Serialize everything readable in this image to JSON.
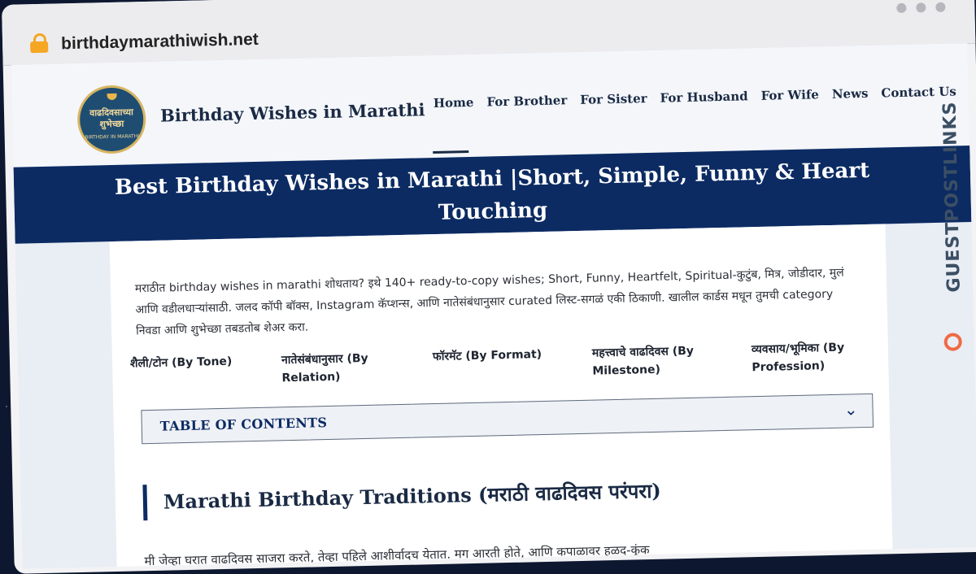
{
  "browser": {
    "url": "birthdaymarathiwish.net"
  },
  "site": {
    "logo_text_top": "वाढदिवसाच्या",
    "logo_text_main": "शुभेच्छा",
    "logo_text_bottom": "BIRTHDAY IN MARATHI",
    "title": "Birthday Wishes in Marathi",
    "nav": [
      "Home",
      "For Brother",
      "For Sister",
      "For Husband",
      "For Wife",
      "News",
      "Contact Us"
    ]
  },
  "hero": {
    "heading": "Best Birthday Wishes in Marathi |Short, Simple, Funny & Heart Touching"
  },
  "intro": {
    "text": "मराठीत birthday wishes in marathi शोधताय? इथे 140+ ready-to-copy wishes; Short, Funny, Heartfelt, Spiritual-कुटुंब, मित्र, जोडीदार, मुलं आणि वडीलधाऱ्यांसाठी. जलद कॉपी बॉक्स, Instagram कॅप्शन्स, आणि नातेसंबंधानुसार curated लिस्ट-सगळं एकी ठिकाणी. खालील कार्डस मधून तुमची category निवडा आणि शुभेच्छा तबडतोब शेअर करा."
  },
  "categories": [
    "शैली/टोन (By Tone)",
    "नातेसंबंधानुसार (By Relation)",
    "फॉरमॅट (By Format)",
    "महत्त्वाचे वाढदिवस (By Milestone)",
    "व्यवसाय/भूमिका (By Profession)"
  ],
  "toc": {
    "title": "TABLE OF CONTENTS",
    "icon": "chevron-down-icon"
  },
  "section": {
    "heading": "Marathi Birthday Traditions (मराठी वाढदिवस परंपरा)",
    "paragraph": "मी जेव्हा घरात वाढदिवस साजरा करते, तेव्हा पहिले आशीर्वादच येतात. मग आरती होते, आणि कपाळावर हळद-कुंक"
  },
  "watermark": {
    "text": "GUESTPOSTLINKS"
  },
  "colors": {
    "accent": "#0c2b63",
    "logo_bg": "#1f4d72",
    "logo_gold": "#d7b562",
    "lock": "#f5a623",
    "watermark_icon": "#ef6a44"
  }
}
